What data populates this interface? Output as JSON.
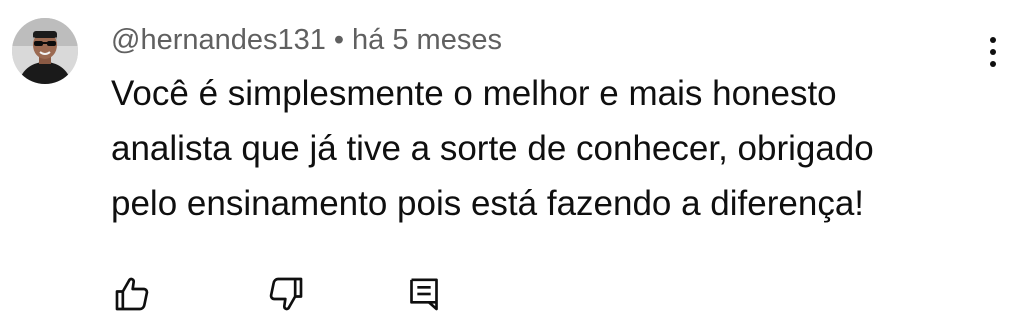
{
  "comment": {
    "author": "@hernandes131",
    "separator": "•",
    "timestamp": "há 5 meses",
    "text_lines": [
      "Você é simplesmente o melhor e mais honesto",
      "analista que já tive a sorte de conhecer, obrigado",
      "pelo ensinamento pois está fazendo a diferença!"
    ]
  },
  "icons": {
    "avatar": "avatar",
    "menu": "more-vert-icon",
    "like": "thumb-up-icon",
    "dislike": "thumb-down-icon",
    "reply": "reply-comment-icon"
  },
  "colors": {
    "text_primary": "#0f0f0f",
    "text_secondary": "#606060",
    "background": "#ffffff"
  }
}
